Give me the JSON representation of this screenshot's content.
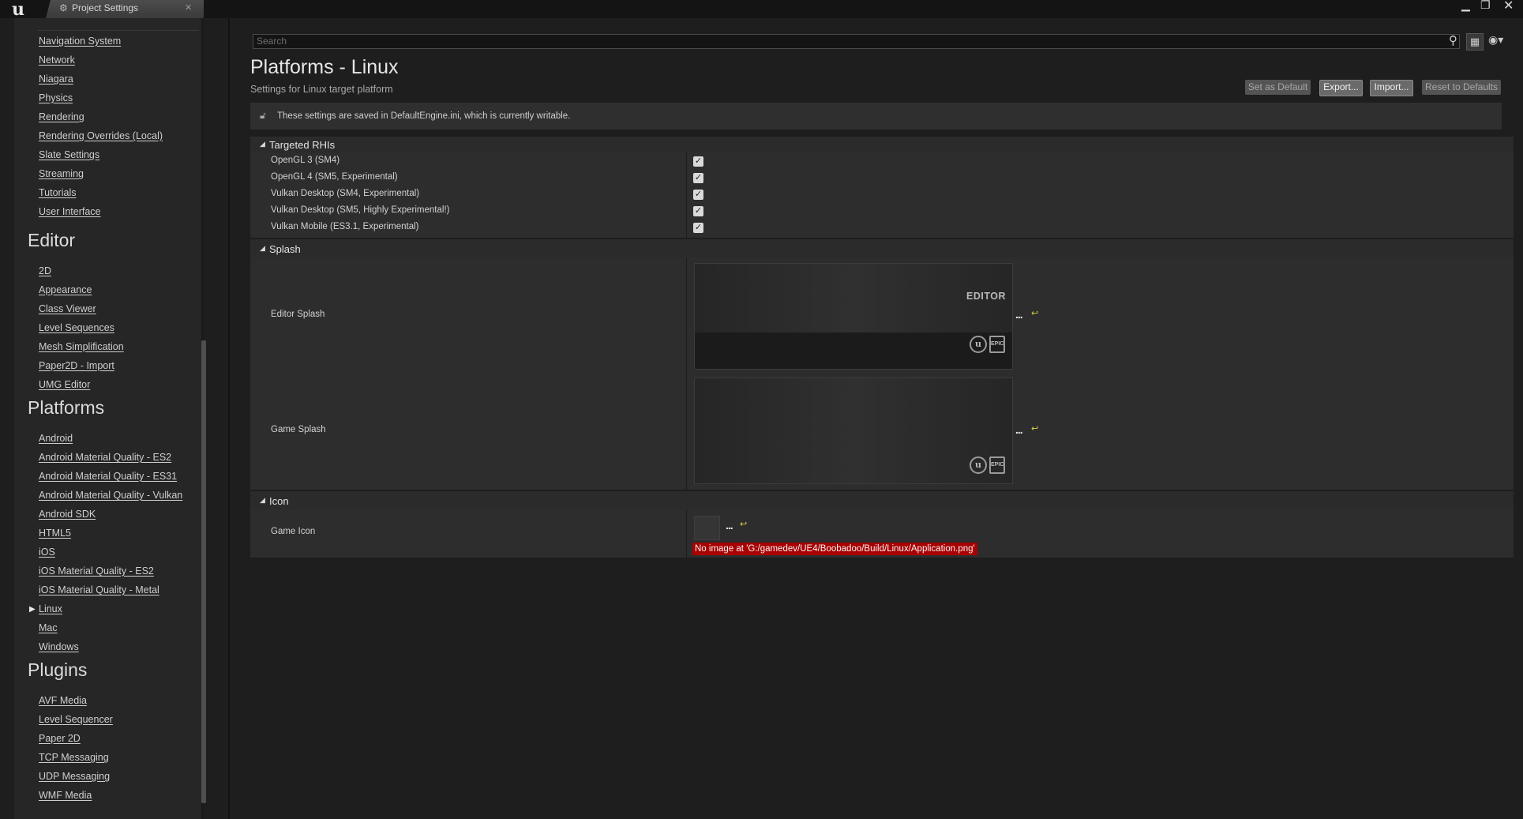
{
  "window": {
    "tab_title": "Project Settings",
    "tab_icon": "gear-icon",
    "controls": [
      "minimize",
      "maximize",
      "close"
    ]
  },
  "sidebar": {
    "groups": [
      {
        "items": [
          "Navigation System",
          "Network",
          "Niagara",
          "Physics",
          "Rendering",
          "Rendering Overrides (Local)",
          "Slate Settings",
          "Streaming",
          "Tutorials",
          "User Interface"
        ]
      },
      {
        "title": "Editor",
        "items": [
          "2D",
          "Appearance",
          "Class Viewer",
          "Level Sequences",
          "Mesh Simplification",
          "Paper2D - Import",
          "UMG Editor"
        ]
      },
      {
        "title": "Platforms",
        "items": [
          "Android",
          "Android Material Quality - ES2",
          "Android Material Quality - ES31",
          "Android Material Quality - Vulkan",
          "Android SDK",
          "HTML5",
          "iOS",
          "iOS Material Quality - ES2",
          "iOS Material Quality - Metal",
          "Linux",
          "Mac",
          "Windows"
        ],
        "selected": "Linux"
      },
      {
        "title": "Plugins",
        "items": [
          "AVF Media",
          "Level Sequencer",
          "Paper 2D",
          "TCP Messaging",
          "UDP Messaging",
          "WMF Media"
        ]
      }
    ]
  },
  "search": {
    "placeholder": "Search"
  },
  "page": {
    "title": "Platforms - Linux",
    "subtitle": "Settings for Linux target platform",
    "buttons": {
      "set_default": "Set as Default",
      "export": "Export...",
      "import": "Import...",
      "reset": "Reset to Defaults"
    },
    "notice": "These settings are saved in DefaultEngine.ini, which is currently writable."
  },
  "sections": {
    "rhis": {
      "title": "Targeted RHIs",
      "rows": [
        {
          "label": "OpenGL 3 (SM4)",
          "checked": true
        },
        {
          "label": "OpenGL 4 (SM5, Experimental)",
          "checked": true
        },
        {
          "label": "Vulkan Desktop (SM4, Experimental)",
          "checked": true
        },
        {
          "label": "Vulkan Desktop (SM5, Highly Experimental!)",
          "checked": true
        },
        {
          "label": "Vulkan Mobile (ES3.1, Experimental)",
          "checked": true
        }
      ]
    },
    "splash": {
      "title": "Splash",
      "editor_label": "Editor Splash",
      "editor_badge": "EDITOR",
      "game_label": "Game Splash"
    },
    "icon": {
      "title": "Icon",
      "game_icon_label": "Game Icon",
      "error": "No image at 'G:/gamedev/UE4/Boobadoo/Build/Linux/Application.png'"
    }
  },
  "colors": {
    "background": "#1e1e1e",
    "panel": "#2d2d2d",
    "error": "#a80000",
    "reset_arrow": "#d6d04a"
  }
}
